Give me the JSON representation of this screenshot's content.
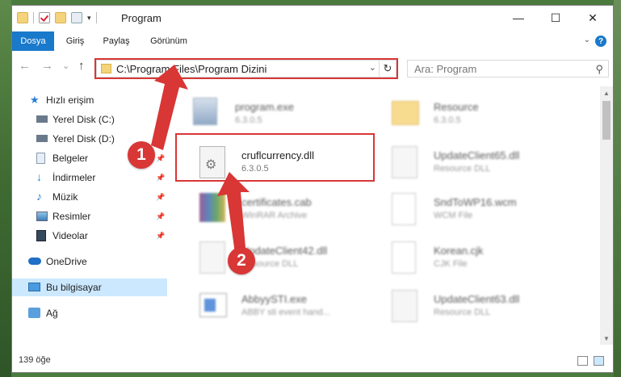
{
  "window": {
    "title": "Program",
    "controls": {
      "minimize": "—",
      "maximize": "☐",
      "close": "✕"
    }
  },
  "ribbon": {
    "tabs": [
      "Dosya",
      "Giriş",
      "Paylaş",
      "Görünüm"
    ],
    "active_tab": "Dosya",
    "help": "?"
  },
  "nav": {
    "back": "←",
    "forward": "→",
    "recent": "⌄",
    "up": "↑",
    "address": "C:\\Program Files\\Program Dizini",
    "search_placeholder": "Ara: Program"
  },
  "sidebar": {
    "items": [
      {
        "label": "Hızlı erişim",
        "icon": "star-icon"
      },
      {
        "label": "Yerel Disk (C:)",
        "icon": "drive-icon"
      },
      {
        "label": "Yerel Disk (D:)",
        "icon": "drive-icon"
      },
      {
        "label": "Belgeler",
        "icon": "documents-icon"
      },
      {
        "label": "İndirmeler",
        "icon": "download-icon"
      },
      {
        "label": "Müzik",
        "icon": "music-icon"
      },
      {
        "label": "Resimler",
        "icon": "pictures-icon"
      },
      {
        "label": "Videolar",
        "icon": "videos-icon"
      },
      {
        "label": "OneDrive",
        "icon": "cloud-icon"
      },
      {
        "label": "Bu bilgisayar",
        "icon": "computer-icon"
      },
      {
        "label": "Ağ",
        "icon": "network-icon"
      }
    ],
    "selected": "Bu bilgisayar"
  },
  "files": [
    {
      "name": "program.exe",
      "sub": "6.3.0.5",
      "icon": "program-icon",
      "blurred": true
    },
    {
      "name": "Resource",
      "sub": "6.3.0.5",
      "icon": "folder-icon",
      "blurred": true
    },
    {
      "name": "cruflcurrency.dll",
      "sub": "6.3.0.5",
      "icon": "dll-gear-icon",
      "blurred": false
    },
    {
      "name": "UpdateClient65.dll",
      "sub": "Resource DLL",
      "icon": "dll-gear-icon",
      "blurred": true
    },
    {
      "name": "certificates.cab",
      "sub": "WinRAR Archive",
      "icon": "archive-icon",
      "blurred": true
    },
    {
      "name": "SndToWP16.wcm",
      "sub": "WCM File",
      "icon": "blank-file-icon",
      "blurred": true
    },
    {
      "name": "UpdateClient42.dll",
      "sub": "Resource DLL",
      "icon": "dll-gear-icon",
      "blurred": true
    },
    {
      "name": "Korean.cjk",
      "sub": "CJK File",
      "icon": "blank-file-icon",
      "blurred": true
    },
    {
      "name": "AbbyySTI.exe",
      "sub": "ABBY sti event hand...",
      "icon": "exe-window-icon",
      "blurred": true
    },
    {
      "name": "UpdateClient63.dll",
      "sub": "Resource DLL",
      "icon": "dll-gear-icon",
      "blurred": true
    }
  ],
  "status": {
    "count": "139 öğe"
  },
  "markers": [
    "1",
    "2"
  ],
  "colors": {
    "accent": "#1979ca",
    "highlight": "#d93636",
    "selected_bg": "#cce8ff"
  }
}
